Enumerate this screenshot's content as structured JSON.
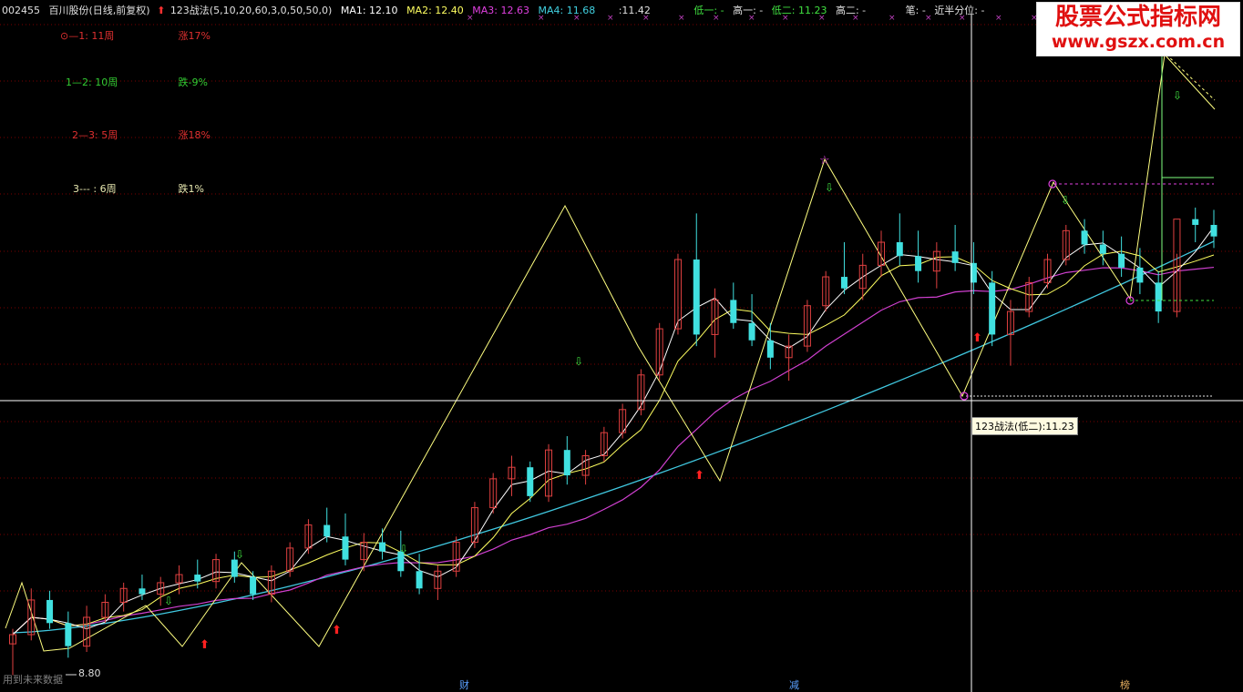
{
  "header": {
    "code": "002455",
    "name": "百川股份(日线,前复权)",
    "indicator": "123战法(5,10,20,60,3,0,50,50,0)",
    "ma1": "MA1: 12.10",
    "ma2": "MA2: 12.40",
    "ma3": "MA3: 12.63",
    "ma4": "MA4: 11.68",
    "v1": ":11.42",
    "v2": "低一: -",
    "v3": "高一: -",
    "v4": "低二: 11.23",
    "v5": "高二: -",
    "v6": "笔: -",
    "v7": "近半分位: -"
  },
  "stats": [
    {
      "label": "⊙—1:  11周",
      "value": "涨17%",
      "labelColor": "#e03030",
      "valueColor": "#e03030"
    },
    {
      "label": "1—2:  10周",
      "value": "跌-9%",
      "labelColor": "#33cc33",
      "valueColor": "#33cc33"
    },
    {
      "label": "2—3:  5周",
      "value": "涨18%",
      "labelColor": "#e03030",
      "valueColor": "#e03030"
    },
    {
      "label": "3---  :  6周",
      "value": "跌1%",
      "labelColor": "#e8e8b0",
      "valueColor": "#e8e8b0"
    }
  ],
  "watermark": {
    "line1": "股票公式指标网",
    "line2": "www.gszx.com.cn"
  },
  "tooltip": "123战法(低二):11.23",
  "low_label": "8.80",
  "footer": "用到未来数据",
  "x_marks": [
    {
      "text": "财",
      "color": "#5aa0ff"
    },
    {
      "text": "减",
      "color": "#5aa0ff"
    },
    {
      "text": "榜",
      "color": "#e8b060"
    }
  ],
  "colors": {
    "up": "#e04040",
    "down": "#40e0e0",
    "zig": "#ffff80",
    "ma_slow": "#40c8e0",
    "ma_mid": "#d040d0",
    "cross": "#ffffff"
  },
  "chart_data": {
    "type": "candlestick",
    "series_ma": [
      "MA1",
      "MA2",
      "MA3",
      "MA4"
    ],
    "price_ylim": [
      8.6,
      12.6
    ],
    "candles": [
      [
        8.82,
        8.95,
        8.55,
        8.9
      ],
      [
        8.9,
        9.3,
        8.85,
        9.2
      ],
      [
        9.2,
        9.28,
        8.95,
        9.0
      ],
      [
        9.0,
        9.1,
        8.7,
        8.8
      ],
      [
        8.8,
        9.15,
        8.75,
        9.05
      ],
      [
        9.05,
        9.25,
        9.0,
        9.18
      ],
      [
        9.18,
        9.35,
        9.1,
        9.3
      ],
      [
        9.3,
        9.42,
        9.2,
        9.25
      ],
      [
        9.25,
        9.4,
        9.15,
        9.35
      ],
      [
        9.35,
        9.5,
        9.25,
        9.42
      ],
      [
        9.42,
        9.55,
        9.3,
        9.36
      ],
      [
        9.36,
        9.6,
        9.3,
        9.55
      ],
      [
        9.55,
        9.62,
        9.35,
        9.4
      ],
      [
        9.4,
        9.45,
        9.2,
        9.25
      ],
      [
        9.25,
        9.5,
        9.18,
        9.45
      ],
      [
        9.45,
        9.7,
        9.4,
        9.65
      ],
      [
        9.65,
        9.9,
        9.6,
        9.85
      ],
      [
        9.85,
        10.0,
        9.7,
        9.75
      ],
      [
        9.75,
        9.95,
        9.5,
        9.55
      ],
      [
        9.55,
        9.78,
        9.45,
        9.7
      ],
      [
        9.7,
        9.82,
        9.55,
        9.62
      ],
      [
        9.62,
        9.8,
        9.4,
        9.45
      ],
      [
        9.45,
        9.6,
        9.25,
        9.3
      ],
      [
        9.3,
        9.5,
        9.2,
        9.45
      ],
      [
        9.45,
        9.75,
        9.4,
        9.7
      ],
      [
        9.7,
        10.05,
        9.65,
        10.0
      ],
      [
        10.0,
        10.3,
        9.95,
        10.25
      ],
      [
        10.25,
        10.45,
        10.1,
        10.35
      ],
      [
        10.35,
        10.4,
        10.05,
        10.1
      ],
      [
        10.1,
        10.55,
        10.05,
        10.5
      ],
      [
        10.5,
        10.62,
        10.2,
        10.28
      ],
      [
        10.28,
        10.5,
        10.2,
        10.45
      ],
      [
        10.45,
        10.7,
        10.4,
        10.65
      ],
      [
        10.65,
        10.9,
        10.6,
        10.85
      ],
      [
        10.85,
        11.2,
        10.8,
        11.15
      ],
      [
        11.15,
        11.6,
        11.1,
        11.55
      ],
      [
        11.55,
        12.2,
        11.5,
        12.15
      ],
      [
        12.15,
        12.55,
        11.4,
        11.5
      ],
      [
        11.5,
        11.9,
        11.3,
        11.8
      ],
      [
        11.8,
        11.95,
        11.55,
        11.6
      ],
      [
        11.6,
        11.85,
        11.4,
        11.45
      ],
      [
        11.45,
        11.6,
        11.2,
        11.3
      ],
      [
        11.3,
        11.5,
        11.1,
        11.4
      ],
      [
        11.4,
        11.8,
        11.35,
        11.75
      ],
      [
        11.75,
        12.05,
        11.7,
        12.0
      ],
      [
        12.0,
        12.3,
        11.85,
        11.9
      ],
      [
        11.9,
        12.2,
        11.8,
        12.1
      ],
      [
        12.1,
        12.4,
        12.0,
        12.3
      ],
      [
        12.3,
        12.55,
        12.1,
        12.18
      ],
      [
        12.18,
        12.4,
        11.95,
        12.05
      ],
      [
        12.05,
        12.3,
        11.9,
        12.22
      ],
      [
        12.22,
        12.45,
        12.05,
        12.12
      ],
      [
        12.12,
        12.3,
        11.85,
        11.95
      ],
      [
        11.95,
        12.05,
        11.4,
        11.5
      ],
      [
        11.5,
        11.8,
        11.23,
        11.7
      ],
      [
        11.7,
        12.0,
        11.65,
        11.95
      ],
      [
        11.95,
        12.2,
        11.9,
        12.15
      ],
      [
        12.15,
        12.45,
        12.1,
        12.4
      ],
      [
        12.4,
        12.5,
        12.2,
        12.28
      ],
      [
        12.28,
        12.4,
        12.1,
        12.2
      ],
      [
        12.2,
        12.35,
        12.0,
        12.08
      ],
      [
        12.08,
        12.25,
        11.85,
        11.95
      ],
      [
        11.95,
        12.05,
        11.6,
        11.7
      ],
      [
        11.7,
        12.2,
        11.65,
        12.5
      ],
      [
        12.5,
        12.6,
        12.3,
        12.45
      ],
      [
        12.45,
        12.58,
        12.25,
        12.35
      ]
    ]
  }
}
